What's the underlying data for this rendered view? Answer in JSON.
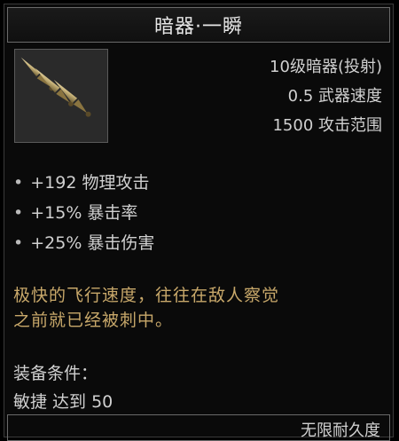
{
  "item": {
    "name": "暗器·一瞬",
    "icon": "throwing-knives-icon",
    "type_line": "10级暗器(投射)",
    "speed_line": "0.5 武器速度",
    "range_line": "1500 攻击范围"
  },
  "stats": [
    {
      "bullet": "•",
      "text": "+192 物理攻击"
    },
    {
      "bullet": "•",
      "text": "+15% 暴击率"
    },
    {
      "bullet": "•",
      "text": "+25% 暴击伤害"
    }
  ],
  "description": {
    "line1": "极快的飞行速度，往往在敌人察觉",
    "line2": "之前就已经被刺中。"
  },
  "requirements": {
    "label": "装备条件：",
    "value": "敏捷 达到 50"
  },
  "durability": "无限耐久度",
  "colors": {
    "description": "#c8a86a",
    "text": "#d0d0d0",
    "border": "#6a6a6a"
  }
}
